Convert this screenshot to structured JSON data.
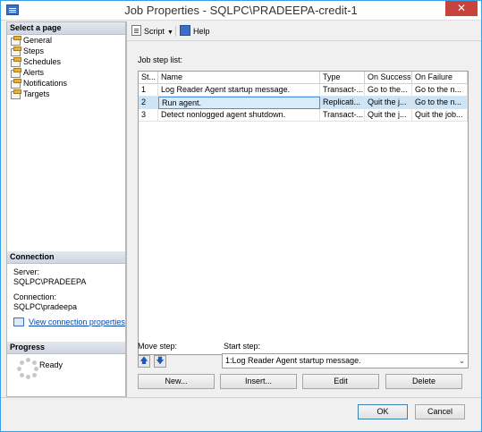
{
  "window": {
    "title": "Job Properties - SQLPC\\PRADEEPA-credit-1",
    "close_label": "✕"
  },
  "left_pane": {
    "select_page_header": "Select a page",
    "pages": [
      {
        "label": "General",
        "icon": "page-icon"
      },
      {
        "label": "Steps",
        "icon": "page-icon"
      },
      {
        "label": "Schedules",
        "icon": "page-icon"
      },
      {
        "label": "Alerts",
        "icon": "page-icon"
      },
      {
        "label": "Notifications",
        "icon": "page-icon"
      },
      {
        "label": "Targets",
        "icon": "page-icon"
      }
    ],
    "connection_header": "Connection",
    "server_label": "Server:",
    "server_value": "SQLPC\\PRADEEPA",
    "connection_label": "Connection:",
    "connection_value": "SQLPC\\pradeepa",
    "view_connection_link": "View connection properties",
    "progress_header": "Progress",
    "progress_status": "Ready"
  },
  "toolbar": {
    "script_label": "Script",
    "help_label": "Help"
  },
  "main": {
    "job_step_list_label": "Job step list:",
    "columns": [
      "St...",
      "Name",
      "Type",
      "On Success",
      "On Failure"
    ],
    "rows": [
      [
        "1",
        "Log Reader Agent startup message.",
        "Transact-...",
        "Go to the...",
        "Go to the n..."
      ],
      [
        "2",
        "Run agent.",
        "Replicati...",
        "Quit the j...",
        "Go to the n..."
      ],
      [
        "3",
        "Detect nonlogged agent shutdown.",
        "Transact-...",
        "Quit the j...",
        "Quit the job..."
      ]
    ],
    "selected_row": 2,
    "move_step_label": "Move step:",
    "move_up_label": "🡅",
    "move_down_label": "🡇",
    "start_step_label": "Start step:",
    "start_step_value": "1:Log Reader Agent startup message.",
    "new_button": "New...",
    "insert_button": "Insert...",
    "edit_button": "Edit",
    "delete_button": "Delete"
  },
  "footer": {
    "ok_button": "OK",
    "cancel_button": "Cancel"
  },
  "colors": {
    "window_border": "#3aa0e6",
    "close_button": "#c7433b",
    "selection": "#cce4f7",
    "link": "#0645ad"
  }
}
